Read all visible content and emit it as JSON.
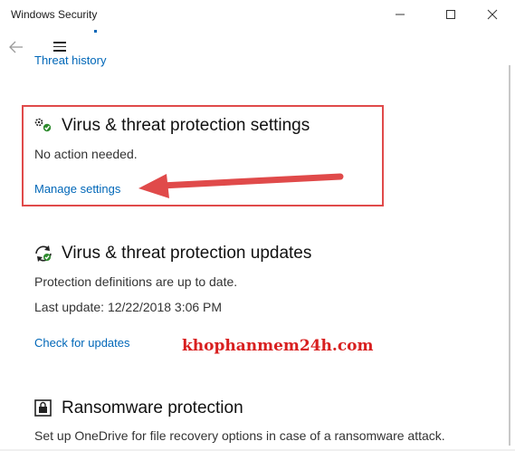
{
  "window": {
    "title": "Windows Security",
    "controls": {
      "minimize": "minimize-icon",
      "maximize": "maximize-icon",
      "close": "close-icon"
    }
  },
  "nav": {
    "back_icon": "back-arrow-icon",
    "menu_icon": "hamburger-icon"
  },
  "threat_history": {
    "label": "Threat history"
  },
  "settings_section": {
    "icon": "gear-settings-icon",
    "title": "Virus & threat protection settings",
    "status": "No action needed.",
    "link": "Manage settings"
  },
  "updates_section": {
    "icon": "refresh-check-icon",
    "title": "Virus & threat protection updates",
    "status": "Protection definitions are up to date.",
    "last_update": "Last update: 12/22/2018 3:06 PM",
    "link": "Check for updates"
  },
  "ransomware_section": {
    "icon": "ransomware-icon",
    "title": "Ransomware protection",
    "description": "Set up OneDrive for file recovery options in case of a ransomware attack."
  },
  "overlay": {
    "watermark": "khophanmem24h.com",
    "highlight_color": "#e04a4a",
    "arrow_color": "#e04a4a"
  },
  "colors": {
    "link": "#0067b8",
    "watermark": "#d81f1f"
  }
}
